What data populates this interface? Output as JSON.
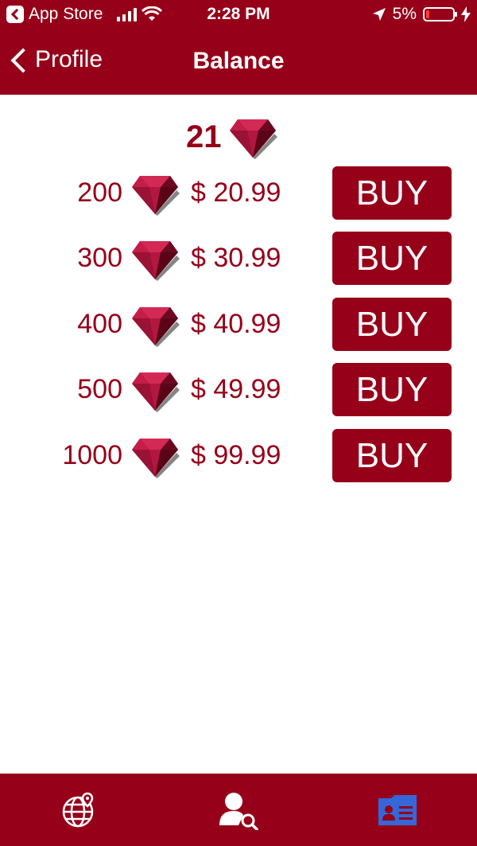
{
  "status_bar": {
    "back_app": "App Store",
    "time": "2:28 PM",
    "battery": "5%"
  },
  "navbar": {
    "back_label": "Profile",
    "title": "Balance"
  },
  "balance": {
    "amount": "21"
  },
  "packages": [
    {
      "quantity": "200",
      "price": "$ 20.99",
      "button": "BUY"
    },
    {
      "quantity": "300",
      "price": "$ 30.99",
      "button": "BUY"
    },
    {
      "quantity": "400",
      "price": "$ 40.99",
      "button": "BUY"
    },
    {
      "quantity": "500",
      "price": "$ 49.99",
      "button": "BUY"
    },
    {
      "quantity": "1000",
      "price": "$ 99.99",
      "button": "BUY"
    }
  ],
  "tabbar": {
    "tabs": [
      {
        "icon": "globe-location-icon",
        "active": false
      },
      {
        "icon": "user-search-icon",
        "active": false
      },
      {
        "icon": "contact-card-icon",
        "active": true
      }
    ]
  },
  "colors": {
    "brand": "#960019",
    "active_tab": "#3567d8"
  }
}
